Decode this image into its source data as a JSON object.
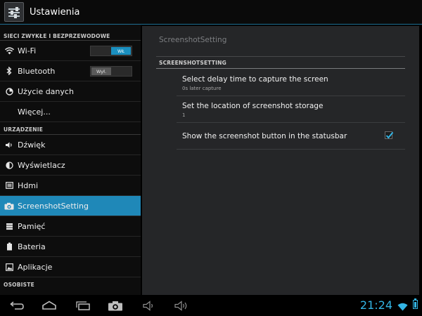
{
  "actionbar": {
    "title": "Ustawienia"
  },
  "sidebar": {
    "sections": [
      {
        "header": "SIECI ZWYKŁE I BEZPRZEWODOWE",
        "items": [
          {
            "label": "Wi-Fi",
            "icon": "wifi-icon",
            "toggle": {
              "state": "on",
              "text": "WŁ"
            }
          },
          {
            "label": "Bluetooth",
            "icon": "bluetooth-icon",
            "toggle": {
              "state": "off",
              "text": "Wył."
            }
          },
          {
            "label": "Użycie danych",
            "icon": "data-usage-icon"
          },
          {
            "label": "Więcej..."
          }
        ]
      },
      {
        "header": "URZĄDZENIE",
        "items": [
          {
            "label": "Dźwięk",
            "icon": "volume-icon"
          },
          {
            "label": "Wyświetlacz",
            "icon": "display-icon"
          },
          {
            "label": "Hdmi",
            "icon": "hdmi-icon"
          },
          {
            "label": "ScreenshotSetting",
            "icon": "camera-icon",
            "selected": true
          },
          {
            "label": "Pamięć",
            "icon": "storage-icon"
          },
          {
            "label": "Bateria",
            "icon": "battery-icon"
          },
          {
            "label": "Aplikacje",
            "icon": "apps-icon"
          }
        ]
      },
      {
        "header": "OSOBISTE",
        "items": []
      }
    ]
  },
  "content": {
    "title": "ScreenshotSetting",
    "category": "SCREENSHOTSETTING",
    "prefs": [
      {
        "title": "Select delay time to capture the screen",
        "summary": "0s later capture"
      },
      {
        "title": "Set the location of screenshot storage",
        "summary": "1"
      },
      {
        "title": "Show the screenshot button in the statusbar",
        "checked": true
      }
    ]
  },
  "statusbar": {
    "time": "21:24"
  },
  "colors": {
    "accent": "#33b5e5",
    "selected": "#1f88b8",
    "panel": "#252628"
  }
}
